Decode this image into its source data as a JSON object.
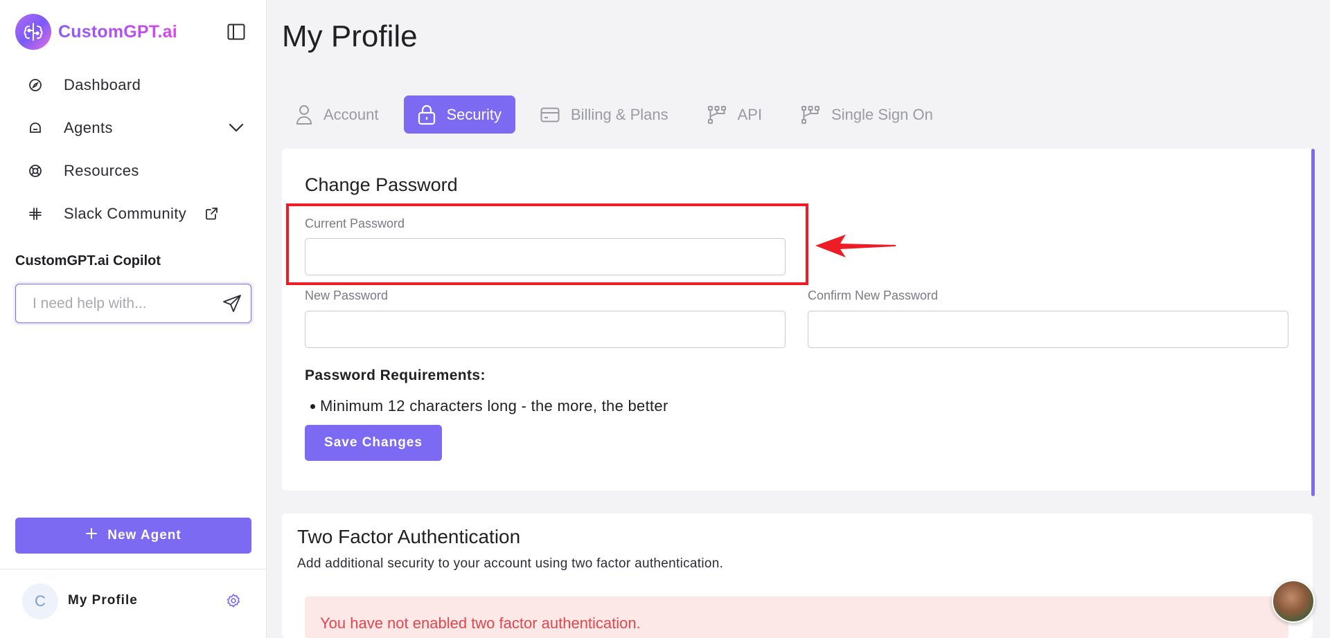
{
  "brand": {
    "name": "CustomGPT.ai"
  },
  "sidebar": {
    "items": [
      {
        "label": "Dashboard",
        "icon": "compass-icon"
      },
      {
        "label": "Agents",
        "icon": "agents-icon",
        "trail": "chevron-down-icon"
      },
      {
        "label": "Resources",
        "icon": "lifebuoy-icon"
      },
      {
        "label": "Slack Community",
        "icon": "slack-icon",
        "trail": "external-link-icon"
      }
    ],
    "copilot": {
      "title": "CustomGPT.ai Copilot",
      "placeholder": "I need help with..."
    },
    "new_agent_label": "New Agent",
    "profile": {
      "initial": "C",
      "name": "My Profile"
    }
  },
  "main": {
    "title": "My Profile",
    "tabs": [
      {
        "label": "Account",
        "active": false
      },
      {
        "label": "Security",
        "active": true
      },
      {
        "label": "Billing & Plans",
        "active": false
      },
      {
        "label": "API",
        "active": false
      },
      {
        "label": "Single Sign On",
        "active": false
      }
    ],
    "change_password": {
      "title": "Change Password",
      "current_label": "Current Password",
      "new_label": "New Password",
      "confirm_label": "Confirm New Password",
      "requirements_title": "Password Requirements:",
      "requirements": [
        "Minimum 12 characters long - the more, the better"
      ],
      "save_label": "Save Changes"
    },
    "two_factor": {
      "title": "Two Factor Authentication",
      "description": "Add additional security to your account using two factor authentication.",
      "alert": "You have not enabled two factor authentication."
    }
  },
  "colors": {
    "accent": "#7c6af2",
    "highlight": "#ee1c25",
    "alert_bg": "#fde8e8",
    "alert_text": "#e0474c"
  }
}
